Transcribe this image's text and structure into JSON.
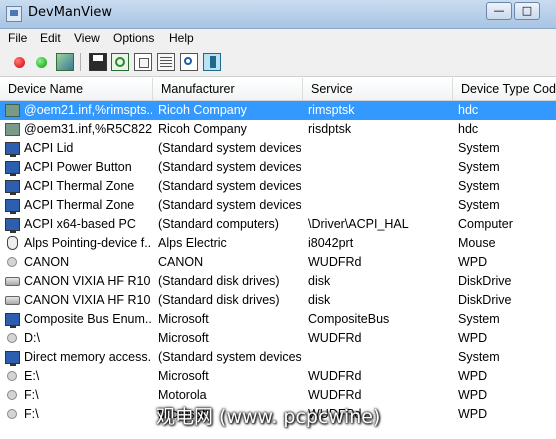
{
  "window": {
    "title": "DevManView"
  },
  "menu": [
    "File",
    "Edit",
    "View",
    "Options",
    "Help"
  ],
  "toolbar": {
    "icons": [
      "disable-red-icon",
      "enable-green-icon",
      "properties-icon",
      "save-icon",
      "refresh-icon",
      "copy-icon",
      "html-report-icon",
      "find-icon",
      "exit-icon"
    ]
  },
  "columns": [
    "Device Name",
    "Manufacturer",
    "Service",
    "Device Type Code"
  ],
  "rows": [
    {
      "icon": "network",
      "name": "@oem21.inf,%rimspts...",
      "mfr": "Ricoh Company",
      "svc": "rimsptsk",
      "type": "hdc",
      "selected": true
    },
    {
      "icon": "network",
      "name": "@oem31.inf,%R5C822...",
      "mfr": "Ricoh Company",
      "svc": "risdptsk",
      "type": "hdc"
    },
    {
      "icon": "monitor",
      "name": "ACPI Lid",
      "mfr": "(Standard system devices)",
      "svc": "",
      "type": "System"
    },
    {
      "icon": "monitor",
      "name": "ACPI Power Button",
      "mfr": "(Standard system devices)",
      "svc": "",
      "type": "System"
    },
    {
      "icon": "monitor",
      "name": "ACPI Thermal Zone",
      "mfr": "(Standard system devices)",
      "svc": "",
      "type": "System"
    },
    {
      "icon": "monitor",
      "name": "ACPI Thermal Zone",
      "mfr": "(Standard system devices)",
      "svc": "",
      "type": "System"
    },
    {
      "icon": "monitor",
      "name": "ACPI x64-based PC",
      "mfr": "(Standard computers)",
      "svc": "\\Driver\\ACPI_HAL",
      "type": "Computer"
    },
    {
      "icon": "mouse",
      "name": "Alps Pointing-device f...",
      "mfr": "Alps Electric",
      "svc": "i8042prt",
      "type": "Mouse"
    },
    {
      "icon": "circle",
      "name": "CANON",
      "mfr": "CANON",
      "svc": "WUDFRd",
      "type": "WPD"
    },
    {
      "icon": "disk",
      "name": "CANON VIXIA HF R10 ...",
      "mfr": "(Standard disk drives)",
      "svc": "disk",
      "type": "DiskDrive"
    },
    {
      "icon": "disk",
      "name": "CANON VIXIA HF R10 ...",
      "mfr": "(Standard disk drives)",
      "svc": "disk",
      "type": "DiskDrive"
    },
    {
      "icon": "monitor",
      "name": "Composite Bus Enum...",
      "mfr": "Microsoft",
      "svc": "CompositeBus",
      "type": "System"
    },
    {
      "icon": "circle",
      "name": "D:\\",
      "mfr": "Microsoft",
      "svc": "WUDFRd",
      "type": "WPD"
    },
    {
      "icon": "monitor",
      "name": "Direct memory access...",
      "mfr": "(Standard system devices)",
      "svc": "",
      "type": "System"
    },
    {
      "icon": "circle",
      "name": "E:\\",
      "mfr": "Microsoft",
      "svc": "WUDFRd",
      "type": "WPD"
    },
    {
      "icon": "circle",
      "name": "F:\\",
      "mfr": "Motorola",
      "svc": "WUDFRd",
      "type": "WPD"
    },
    {
      "icon": "circle",
      "name": "F:\\",
      "mfr": "Microsoft",
      "svc": "WUDFRd",
      "type": "WPD"
    }
  ],
  "watermark": "观电网 (www. pcpcwine)"
}
